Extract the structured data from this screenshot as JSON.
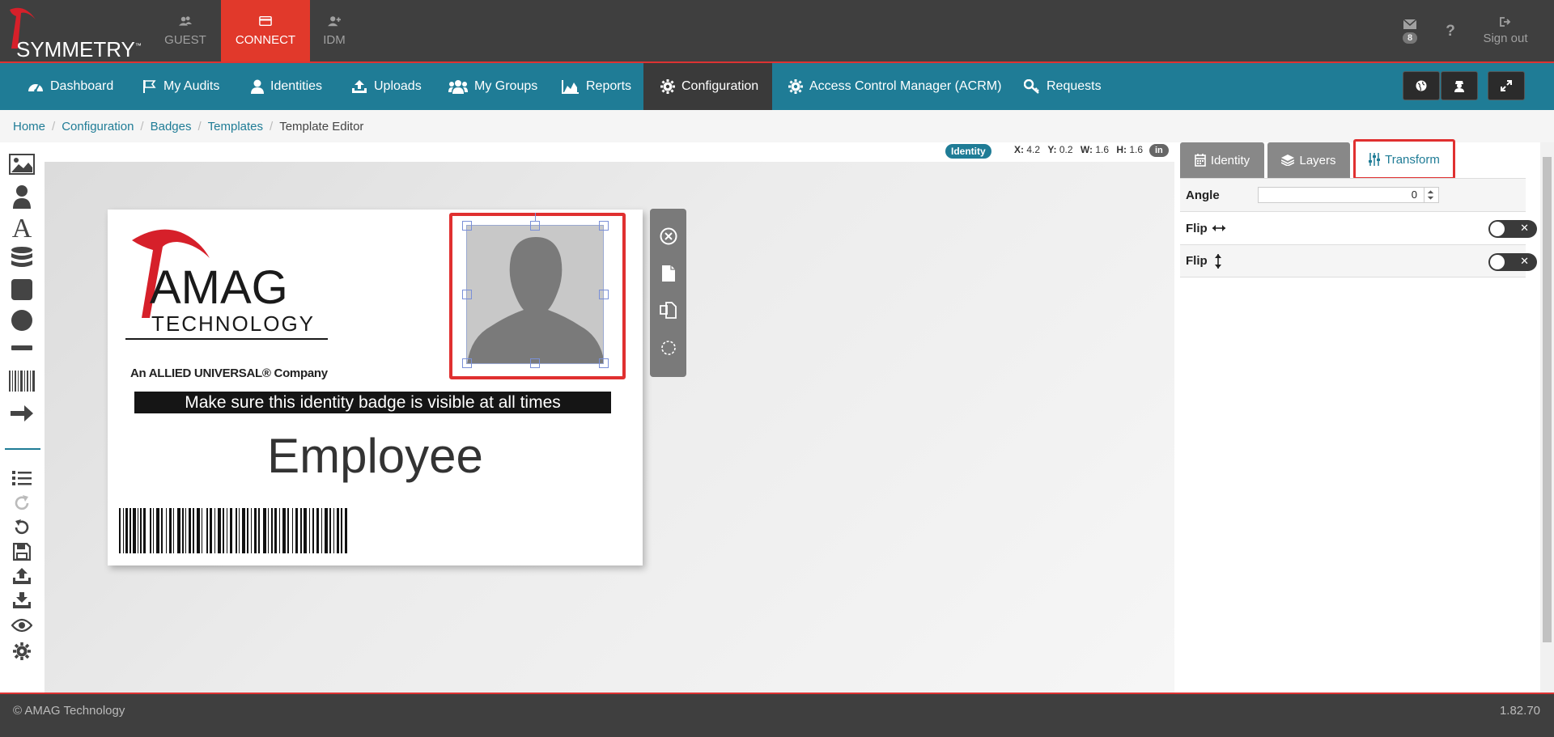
{
  "brand": {
    "name": "SYMMETRY",
    "tm": "™"
  },
  "topnav": [
    {
      "label": "GUEST",
      "icon": "users-icon"
    },
    {
      "label": "CONNECT",
      "icon": "card-icon",
      "active": true
    },
    {
      "label": "IDM",
      "icon": "user-plus-icon"
    }
  ],
  "topright": {
    "messages_count": "8",
    "help": "?",
    "signout": "Sign out"
  },
  "nav": [
    {
      "label": "Dashboard",
      "icon": "dashboard-icon"
    },
    {
      "label": "My Audits",
      "icon": "flag-icon"
    },
    {
      "label": "Identities",
      "icon": "user-icon"
    },
    {
      "label": "Uploads",
      "icon": "upload-icon"
    },
    {
      "label": "My Groups",
      "icon": "group-icon"
    },
    {
      "label": "Reports",
      "icon": "area-chart-icon"
    },
    {
      "label": "Configuration",
      "icon": "gear-icon",
      "active": true
    },
    {
      "label": "Access Control Manager (ACRM)",
      "icon": "gear-icon"
    },
    {
      "label": "Requests",
      "icon": "key-icon"
    }
  ],
  "breadcrumb": [
    "Home",
    "Configuration",
    "Badges",
    "Templates",
    "Template Editor"
  ],
  "editor": {
    "selected_type": "Identity",
    "coords": {
      "x_label": "X:",
      "x": "4.2",
      "y_label": "Y:",
      "y": "0.2",
      "w_label": "W:",
      "w": "1.6",
      "h_label": "H:",
      "h": "1.6"
    },
    "unit": "in"
  },
  "badge": {
    "logo_main": "AMAG",
    "logo_sub": "TECHNOLOGY",
    "tagline": "An ALLIED UNIVERSAL® Company",
    "banner": "Make sure this identity badge is visible at all times",
    "title": "Employee"
  },
  "panel": {
    "tabs": [
      {
        "label": "Identity",
        "icon": "calendar-icon"
      },
      {
        "label": "Layers",
        "icon": "layers-icon"
      },
      {
        "label": "Transform",
        "icon": "sliders-icon",
        "active": true
      }
    ],
    "angle_label": "Angle",
    "angle_value": "0",
    "flip_h_label": "Flip",
    "flip_v_label": "Flip",
    "toggle_x": "✕"
  },
  "footer": {
    "copyright": "© AMAG Technology",
    "version": "1.82.70"
  },
  "colors": {
    "teal": "#1f7c96",
    "red": "#e1392b",
    "dark": "#3f3f3f"
  }
}
